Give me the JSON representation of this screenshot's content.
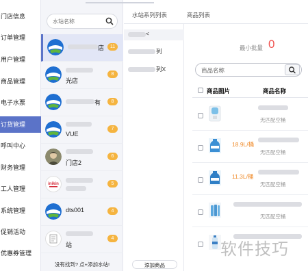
{
  "nav": {
    "items": [
      {
        "label": "门店信息",
        "active": false
      },
      {
        "label": "订单管理",
        "active": false
      },
      {
        "label": "用户管理",
        "active": false
      },
      {
        "label": "商品管理",
        "active": false
      },
      {
        "label": "电子水票",
        "active": false
      },
      {
        "label": "订货管理",
        "active": true
      },
      {
        "label": "呼叫中心",
        "active": false
      },
      {
        "label": "财务管理",
        "active": false
      },
      {
        "label": "工人管理",
        "active": false
      },
      {
        "label": "系统管理",
        "active": false
      },
      {
        "label": "促销活动",
        "active": false
      },
      {
        "label": "优惠券管理",
        "active": false
      }
    ],
    "active_color": "#5b73c8"
  },
  "stores": {
    "search_placeholder": "水站名称",
    "not_found_text": "没有找到? 点+添加水站!",
    "items": [
      {
        "name_suffix": "店",
        "count": "11",
        "avatar": "globe-avatar",
        "selected": true
      },
      {
        "name_suffix": "光店",
        "count": "8",
        "avatar": "globe-avatar",
        "selected": false
      },
      {
        "name_suffix": "有",
        "count": "8",
        "avatar": "globe-avatar",
        "selected": false
      },
      {
        "name_suffix": "VUE",
        "count": "7",
        "avatar": "globe-avatar",
        "selected": false
      },
      {
        "name_suffix": "门店2",
        "count": "6",
        "avatar": "photo-avatar",
        "selected": false
      },
      {
        "name_suffix": "",
        "count": "5",
        "avatar": "inikin-logo-avatar",
        "selected": false
      },
      {
        "name_suffix": "dts001",
        "count": "4",
        "avatar": "globe-avatar",
        "selected": false
      },
      {
        "name_suffix": "站",
        "count": "4",
        "avatar": "document-avatar",
        "selected": false
      }
    ],
    "badge_color": "#f5b440"
  },
  "tabs": {
    "series": "水站系列列表",
    "goods": "商品列表"
  },
  "series": {
    "items": [
      {
        "suffix": "<"
      },
      {
        "suffix": "列"
      },
      {
        "suffix": "列X"
      }
    ],
    "add_goods_label": "添加商品"
  },
  "goods": {
    "min_batch_label": "最小批量",
    "min_batch_value": "0",
    "search_placeholder": "商品名称",
    "col_image": "商品图片",
    "col_name": "商品名称",
    "rows": [
      {
        "price": "",
        "bucket": "无匹配空桶",
        "thumb": "water-dispenser-thumb"
      },
      {
        "price": "18.9L/桶",
        "bucket": "无匹配空桶",
        "thumb": "water-bottle-thumb"
      },
      {
        "price": "11.3L/桶",
        "bucket": "无匹配空桶",
        "thumb": "water-bottle-thumb"
      },
      {
        "price": "",
        "bucket": "无匹配空桶",
        "thumb": "water-pack-thumb"
      },
      {
        "price": "",
        "bucket": "",
        "thumb": "bottle-thumb"
      }
    ],
    "accent_red": "#f0524f",
    "price_color": "#f08d2e"
  },
  "watermark": "软件技巧"
}
